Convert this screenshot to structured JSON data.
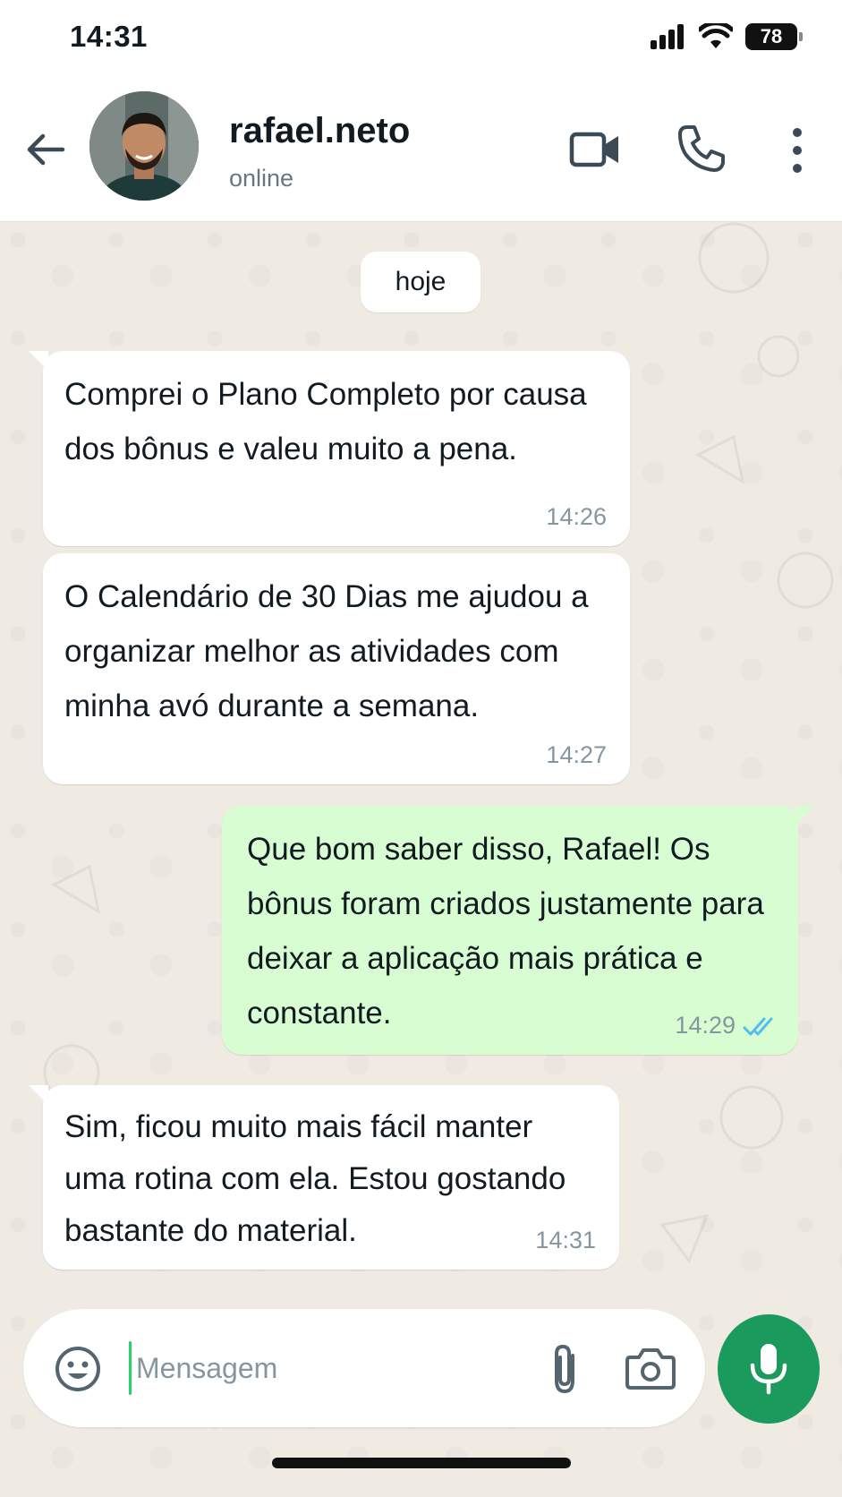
{
  "status_bar": {
    "time": "14:31",
    "battery": "78",
    "icons": [
      "signal-icon",
      "wifi-icon",
      "battery-icon"
    ]
  },
  "header": {
    "contact_name": "rafael.neto",
    "contact_status": "online",
    "icons": [
      "back-arrow-icon",
      "avatar",
      "video-call-icon",
      "phone-call-icon",
      "more-options-icon"
    ]
  },
  "chat": {
    "date_label": "hoje",
    "messages": [
      {
        "direction": "incoming",
        "text": "Comprei o Plano Completo por causa dos bônus e valeu muito a pena.",
        "time": "14:26"
      },
      {
        "direction": "incoming",
        "text": "O Calendário de 30 Dias me ajudou a organizar melhor as atividades com minha avó durante a semana.",
        "time": "14:27"
      },
      {
        "direction": "outgoing",
        "text": "Que bom saber disso, Rafael! Os bônus foram criados justamente para deixar a aplicação mais prática e constante.",
        "time": "14:29",
        "status": "read"
      },
      {
        "direction": "incoming",
        "text": "Sim, ficou muito mais fácil manter uma rotina com ela. Estou gostando bastante do material.",
        "time": "14:31"
      }
    ]
  },
  "composer": {
    "placeholder": "Mensagem",
    "value": "",
    "icons": [
      "emoji-icon",
      "attach-icon",
      "camera-icon",
      "microphone-icon"
    ]
  },
  "colors": {
    "chat_background": "#efeae2",
    "incoming_bubble": "#ffffff",
    "outgoing_bubble": "#d9fdd3",
    "accent_green": "#1a9a5c",
    "read_ticks": "#53bdeb",
    "muted_text": "#8696a0"
  }
}
